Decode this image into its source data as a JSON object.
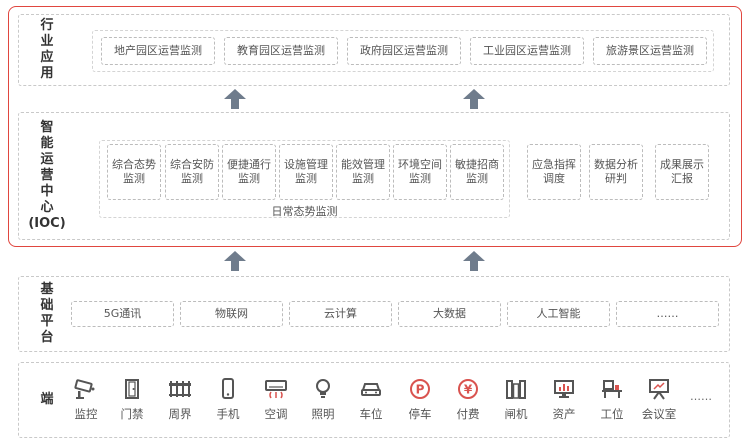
{
  "industry": {
    "label": [
      "行",
      "业",
      "应",
      "用"
    ],
    "items": [
      "地产园区运营监测",
      "教育园区运营监测",
      "政府园区运营监测",
      "工业园区运营监测",
      "旅游景区运营监测"
    ]
  },
  "ioc": {
    "label": [
      "智",
      "能",
      "运",
      "营",
      "中",
      "心",
      "(IOC)"
    ],
    "group_items": [
      [
        "综合态势",
        "监测"
      ],
      [
        "综合安防",
        "监测"
      ],
      [
        "便捷通行",
        "监测"
      ],
      [
        "设施管理",
        "监测"
      ],
      [
        "能效管理",
        "监测"
      ],
      [
        "环境空间",
        "监测"
      ],
      [
        "敏捷招商",
        "监测"
      ]
    ],
    "group_label": "日常态势监测",
    "extra_items": [
      [
        "应急指挥",
        "调度"
      ],
      [
        "数据分析",
        "研判"
      ],
      [
        "成果展示",
        "汇报"
      ]
    ]
  },
  "platform": {
    "label": [
      "基",
      "础",
      "平",
      "台"
    ],
    "items": [
      "5G通讯",
      "物联网",
      "云计算",
      "大数据",
      "人工智能",
      "……"
    ]
  },
  "terminal": {
    "label": "端",
    "items": [
      {
        "icon": "camera-icon",
        "label": "监控"
      },
      {
        "icon": "door-icon",
        "label": "门禁"
      },
      {
        "icon": "fence-icon",
        "label": "周界"
      },
      {
        "icon": "phone-icon",
        "label": "手机"
      },
      {
        "icon": "air-conditioner-icon",
        "label": "空调"
      },
      {
        "icon": "light-bulb-icon",
        "label": "照明"
      },
      {
        "icon": "car-icon",
        "label": "车位"
      },
      {
        "icon": "parking-icon",
        "label": "停车"
      },
      {
        "icon": "yen-coin-icon",
        "label": "付费"
      },
      {
        "icon": "gate-icon",
        "label": "闸机"
      },
      {
        "icon": "asset-monitor-icon",
        "label": "资产"
      },
      {
        "icon": "workstation-icon",
        "label": "工位"
      },
      {
        "icon": "meeting-board-icon",
        "label": "会议室"
      }
    ],
    "more": "……"
  },
  "colors": {
    "frame_red": "#e0463f",
    "arrow": "#6f7c8c",
    "icon": "#555555",
    "dash": "#c9c9c9"
  }
}
